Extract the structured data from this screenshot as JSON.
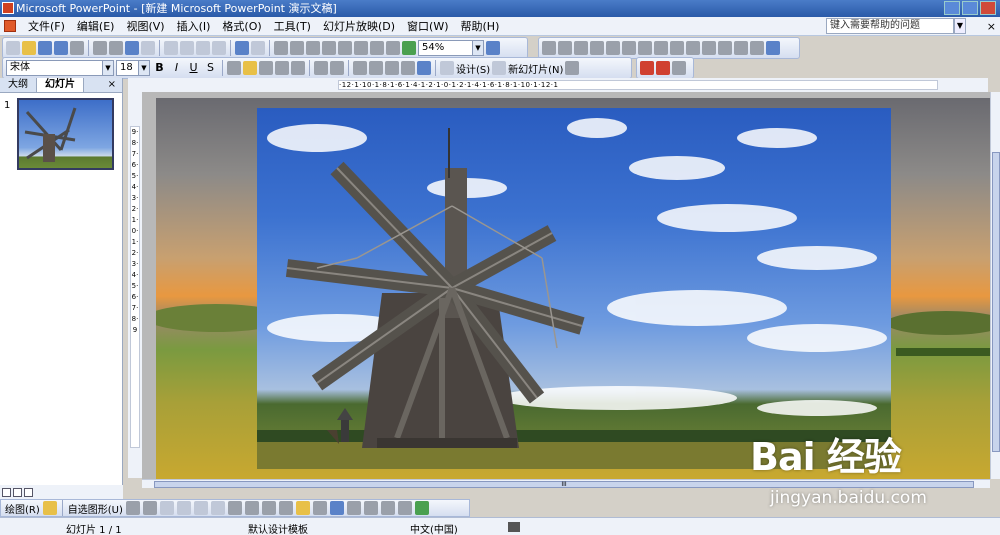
{
  "window": {
    "title": "Microsoft PowerPoint - [新建 Microsoft PowerPoint 演示文稿]"
  },
  "menu": {
    "items": [
      "文件(F)",
      "编辑(E)",
      "视图(V)",
      "插入(I)",
      "格式(O)",
      "工具(T)",
      "幻灯片放映(D)",
      "窗口(W)",
      "帮助(H)"
    ],
    "help_placeholder": "键入需要帮助的问题"
  },
  "standard_toolbar": {
    "zoom": "54%"
  },
  "format_toolbar": {
    "font": "宋体",
    "size": "18",
    "bold": "B",
    "italic": "I",
    "underline": "U",
    "shadow": "S",
    "design_label": "设计(S)",
    "new_slide_label": "新幻灯片(N)"
  },
  "left_panel": {
    "tabs": [
      "大纲",
      "幻灯片"
    ],
    "close": "×",
    "slide_number": "1"
  },
  "ruler": {
    "horizontal": "·12·1·10·1·8·1·6·1·4·1·2·1·0·1·2·1·4·1·6·1·8·1·10·1·12·1",
    "vertical": "9·8·7·6·5·4·3·2·1·0·1·2·3·4·5·6·7·8·9"
  },
  "scroll": {
    "grip": "III"
  },
  "draw_toolbar": {
    "draw_label": "绘图(R)",
    "autoshapes_label": "自选图形(U)"
  },
  "status": {
    "slide": "幻灯片 1 / 1",
    "template": "默认设计模板",
    "language": "中文(中国)"
  },
  "watermark": {
    "logo": "Bai 经验",
    "url": "jingyan.baidu.com"
  },
  "colors": {
    "title_bar": "#2a5aa8",
    "sky": "#3c72d0",
    "accent": "#d04020"
  }
}
